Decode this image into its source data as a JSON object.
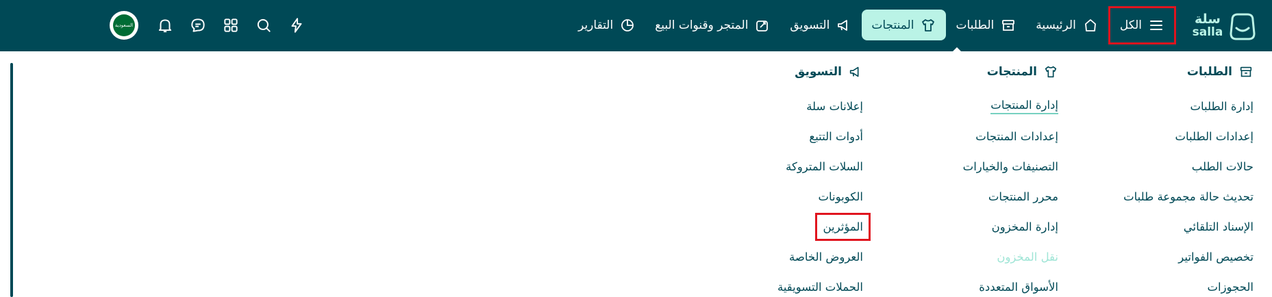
{
  "brand": {
    "name": "سلة",
    "latin": "salla"
  },
  "nav": {
    "all": "الكل",
    "home": "الرئيسية",
    "orders": "الطلبات",
    "products": "المنتجات",
    "marketing": "التسويق",
    "store_channels": "المتجر وقنوات البيع",
    "reports": "التقارير"
  },
  "toolbar": {
    "flag_text": "السعودية",
    "icons": [
      "flash-icon",
      "search-icon",
      "apps-grid-icon",
      "chat-icon",
      "bell-icon"
    ]
  },
  "menu": {
    "orders": {
      "title": "الطلبات",
      "items": [
        "إدارة الطلبات",
        "إعدادات الطلبات",
        "حالات الطلب",
        "تحديث حالة مجموعة طلبات",
        "الإسناد التلقائي",
        "تخصيص الفواتير",
        "الحجوزات"
      ]
    },
    "products": {
      "title": "المنتجات",
      "items": [
        "إدارة المنتجات",
        "إعدادات المنتجات",
        "التصنيفات والخيارات",
        "محرر المنتجات",
        "إدارة المخزون",
        "نقل المخزون",
        "الأسواق المتعددة"
      ]
    },
    "marketing": {
      "title": "التسويق",
      "items": [
        "إعلانات سلة",
        "أدوات التتبع",
        "السلات المتروكة",
        "الكوبونات",
        "المؤثرين",
        "العروض الخاصة",
        "الحملات التسويقية"
      ]
    }
  },
  "colors": {
    "primary": "#004956",
    "accent": "#baf3e6",
    "highlight": "#e0141e"
  }
}
